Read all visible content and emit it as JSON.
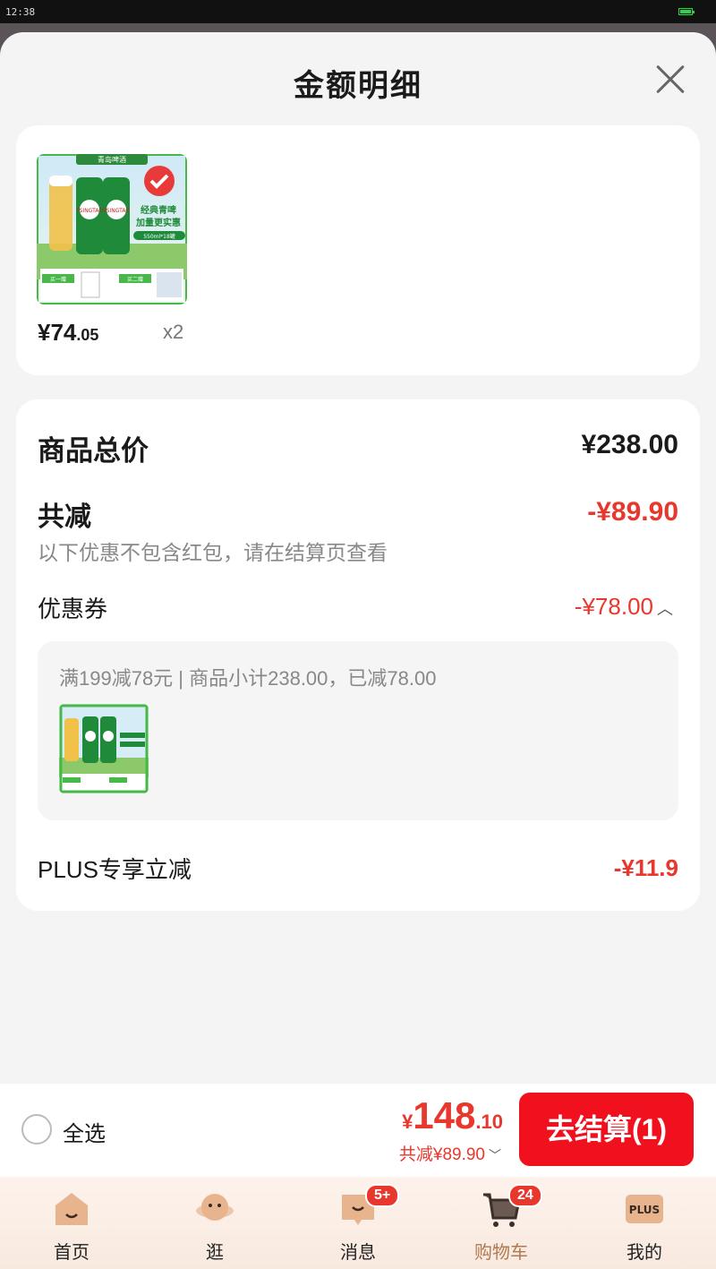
{
  "status_bar": {
    "time": "12:38"
  },
  "sheet": {
    "title": "金额明细"
  },
  "product": {
    "price_int": "¥74",
    "price_dec": ".05",
    "quantity": "x2",
    "image": {
      "brand": "青岛啤酒",
      "can_brand": "TSINGTAO",
      "headline_1": "经典青啤",
      "headline_2": "加量更实惠",
      "spec": "550ml*18罐",
      "offer_1": "买一赠",
      "offer_2": "买二赠"
    }
  },
  "summary": {
    "total_label": "商品总价",
    "total_value": "¥238.00",
    "reduce_label": "共减",
    "reduce_value": "-¥89.90",
    "reduce_note": "以下优惠不包含红包，请在结算页查看",
    "coupon_label": "优惠券",
    "coupon_value": "-¥78.00",
    "coupon_desc": "满199减78元 | 商品小计238.00，已减78.00",
    "plus_label": "PLUS专享立减",
    "plus_value": "-¥11.9"
  },
  "checkout": {
    "select_all": "全选",
    "pay_symbol": "¥",
    "pay_int": "148",
    "pay_dec": ".10",
    "pay_reduce": "共减¥89.90",
    "button": "去结算(1)"
  },
  "tabs": [
    {
      "label": "首页"
    },
    {
      "label": "逛"
    },
    {
      "label": "消息",
      "badge": "5+"
    },
    {
      "label": "购物车",
      "badge": "24"
    },
    {
      "label": "我的",
      "icon_text": "PLUS"
    }
  ],
  "colors": {
    "accent_red": "#e8372c",
    "button_red": "#f0101e",
    "active_tab": "#b07a50"
  }
}
